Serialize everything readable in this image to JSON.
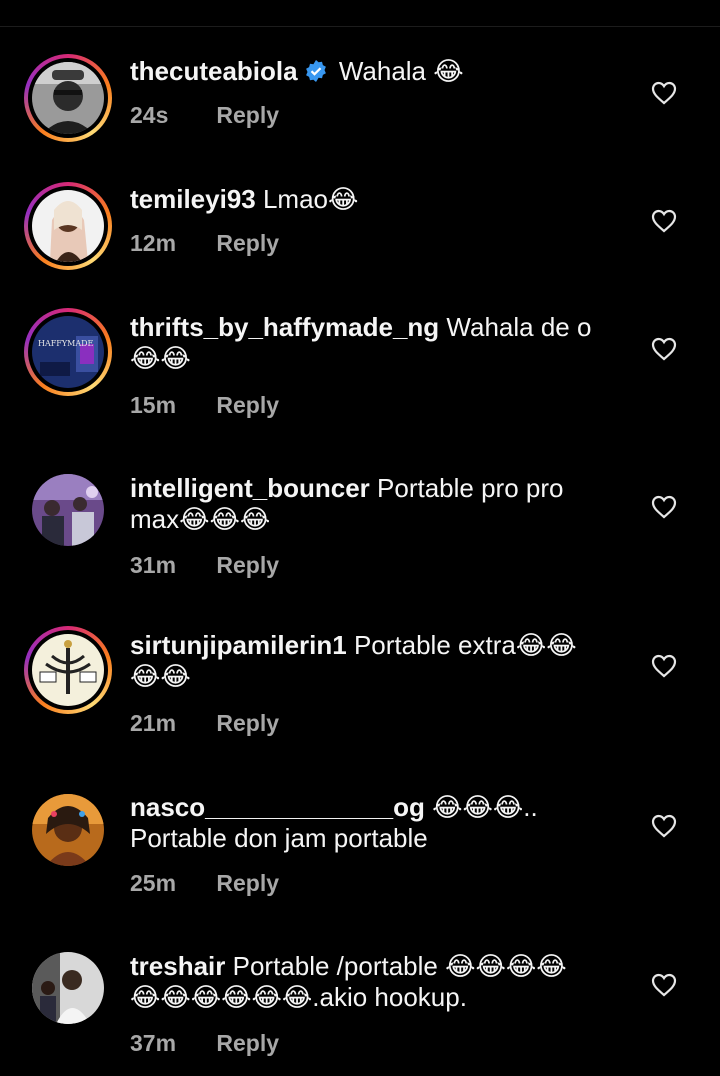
{
  "comments": [
    {
      "username": "thecuteabiola",
      "verified": true,
      "text": " Wahala 😂",
      "time": "24s",
      "reply": "Reply"
    },
    {
      "username": "temileyi93",
      "text": " Lmao😂",
      "time": "12m",
      "reply": "Reply"
    },
    {
      "username": "thrifts_by_haffymade_ng",
      "text": " Wahala de o",
      "text2": "😂😂",
      "time": "15m",
      "reply": "Reply",
      "avatar_text": "HAFFYMADE"
    },
    {
      "username": "intelligent_bouncer",
      "text": " Portable pro pro",
      "text2": "max😂😂😂",
      "time": "31m",
      "reply": "Reply"
    },
    {
      "username": "sirtunjipamilerin1",
      "text": " Portable extra😂😂",
      "text2": "😂😂",
      "time": "21m",
      "reply": "Reply"
    },
    {
      "username": "nasco_____________og",
      "text": " 😂😂😂..",
      "text2": "Portable don jam portable",
      "time": "25m",
      "reply": "Reply"
    },
    {
      "username": "treshair",
      "text": " Portable /portable 😂😂😂😂",
      "text2": "😂😂😂😂😂😂.akio hookup.",
      "time": "37m",
      "reply": "Reply"
    }
  ],
  "icons": {
    "like": "heart-outline-icon",
    "verified": "verified-badge-icon"
  },
  "colors": {
    "background": "#000000",
    "text": "#f5f5f5",
    "meta": "#a8a8a8",
    "verified": "#3897f0"
  }
}
